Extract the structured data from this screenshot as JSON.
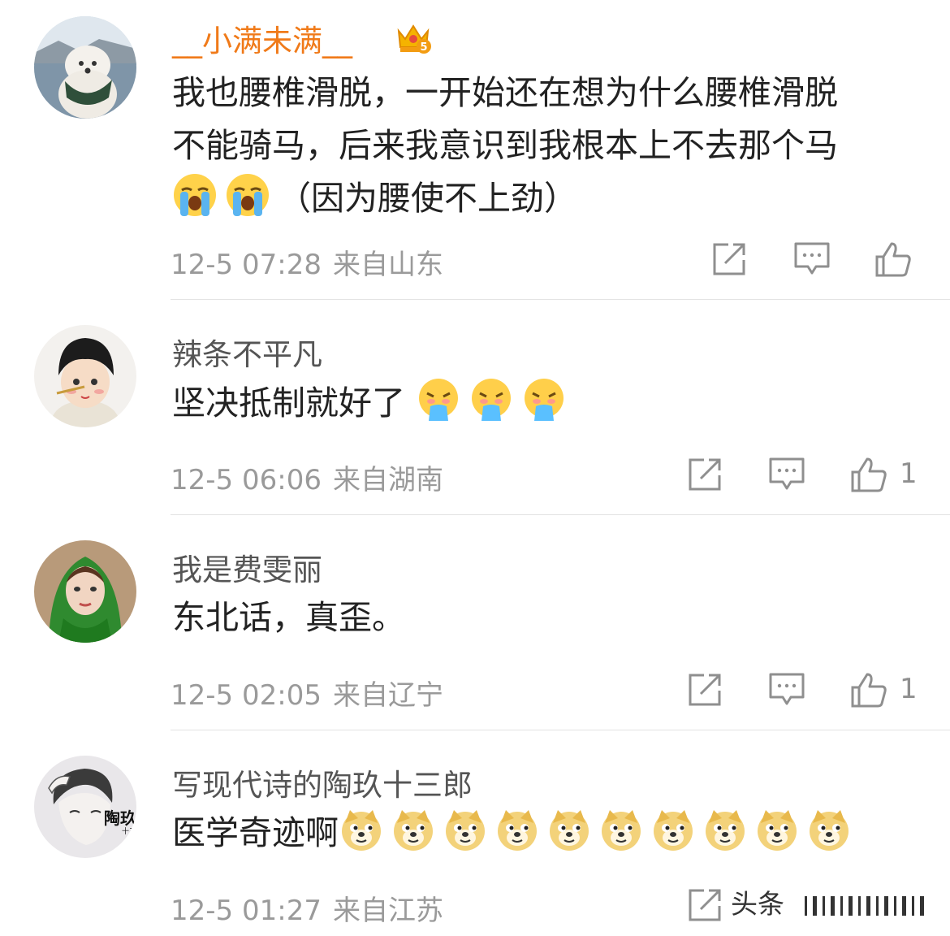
{
  "comments": [
    {
      "username": "__小满未满__",
      "badge": "5",
      "text_lines": [
        "我也腰椎滑脱，一开始还在想为什么腰椎滑脱",
        "不能骑马，后来我意识到我根本上不去那个马"
      ],
      "last_line_suffix": "（因为腰使不上劲）",
      "emoji_name": "loudly-crying-emoji",
      "emoji_count": 2,
      "time": "12-5 07:28",
      "location": "来自山东",
      "likes": ""
    },
    {
      "username": "辣条不平凡",
      "text": "坚决抵制就好了",
      "emoji_name": "vomiting-emoji",
      "emoji_count": 3,
      "time": "12-5 06:06",
      "location": "来自湖南",
      "likes": "1"
    },
    {
      "username": "我是费雯丽",
      "text": "东北话，真歪。",
      "time": "12-5 02:05",
      "location": "来自辽宁",
      "likes": "1"
    },
    {
      "username": "写现代诗的陶玖十三郎",
      "text": "医学奇迹啊",
      "emoji_name": "doge-emoji",
      "emoji_count": 10,
      "avatar_text": "陶玖",
      "avatar_small_text": "十三郎",
      "time": "12-5 01:27",
      "location": "来自江苏"
    }
  ],
  "watermark": "头条",
  "colors": {
    "vip_name": "#f07a19",
    "meta": "#9a9a9a",
    "text": "#222222",
    "divider": "#e3e3e3"
  },
  "icons": [
    "share-icon",
    "comment-icon",
    "like-icon"
  ]
}
